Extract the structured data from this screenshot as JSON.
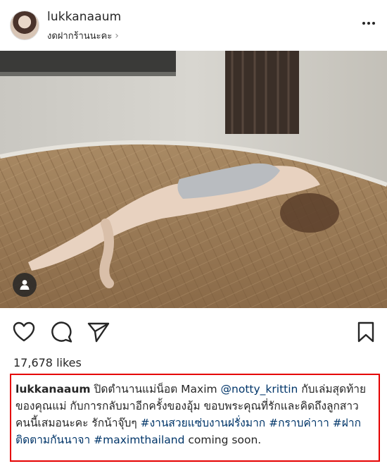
{
  "post": {
    "username": "lukkanaaum",
    "location": "งดฝากร้านนะคะ",
    "likes": "17,678 likes"
  },
  "caption": {
    "username": "lukkanaaum",
    "text_1": " ปิดตำนานแม่น็อต Maxim ",
    "mention": "@notty_krittin",
    "text_2": " กับเล่มสุดท้ายของคุณแม่ กับการกลับมาอีกครั้งของอุ้ม ขอบพระคุณที่รักและคิดถึงลูกสาวคนนี้เสมอนะคะ รักน้าจุ๊บๆ ",
    "hashtag_1": "#งานสวยแซ่บงานฝรั่งมาก",
    "hashtag_2": "#กราบค่าาา",
    "hashtag_3": "#ฝากติดตามกันนาจา",
    "hashtag_4": "#maximthailand",
    "text_3": " coming soon."
  },
  "icons": {
    "more": "more-options-icon",
    "like": "heart-icon",
    "comment": "comment-icon",
    "share": "share-icon",
    "save": "bookmark-icon",
    "tag": "user-tag-icon",
    "location_chevron": "chevron-right-icon"
  },
  "colors": {
    "text": "#262626",
    "link": "#003569",
    "highlight_border": "#e50000"
  }
}
